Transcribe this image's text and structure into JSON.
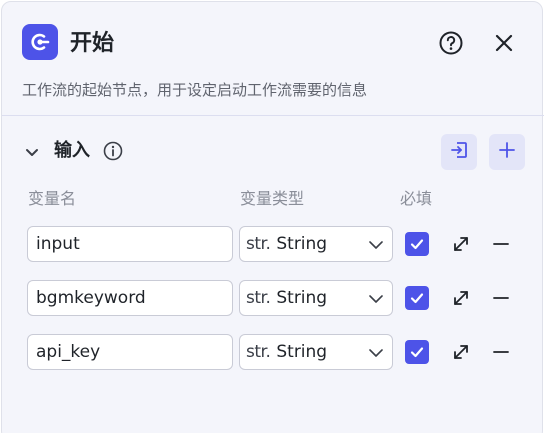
{
  "header": {
    "title": "开始",
    "description": "工作流的起始节点，用于设定启动工作流需要的信息"
  },
  "section": {
    "title": "输入"
  },
  "columns": {
    "name": "变量名",
    "type": "变量类型",
    "required": "必填"
  },
  "rows": [
    {
      "name": "input",
      "type_prefix": "str.",
      "type": "String",
      "required": true
    },
    {
      "name": "bgmkeyword",
      "type_prefix": "str.",
      "type": "String",
      "required": true
    },
    {
      "name": "api_key",
      "type_prefix": "str.",
      "type": "String",
      "required": true
    }
  ],
  "colors": {
    "accent": "#4d53e8",
    "panel_bg": "#f4f5fb",
    "button_bg": "#e3e5f8"
  },
  "icons": [
    "start-logo-icon",
    "help-icon",
    "close-icon",
    "chevron-down-icon",
    "info-icon",
    "import-icon",
    "plus-icon",
    "check-icon",
    "expand-icon",
    "minus-icon"
  ]
}
